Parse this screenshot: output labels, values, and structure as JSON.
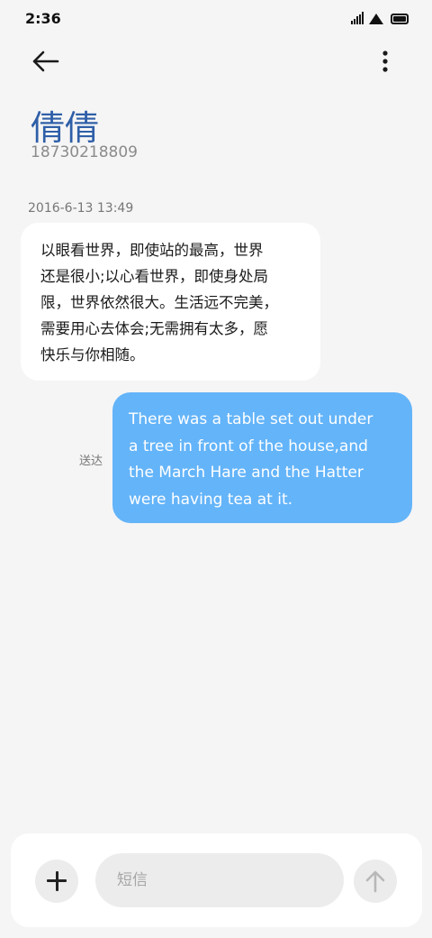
{
  "status_bar": {
    "time": "2:36",
    "icons": [
      "signal-icon",
      "wifi-icon",
      "battery-icon"
    ]
  },
  "toolbar": {
    "back_icon": "arrow-left-icon",
    "more_icon": "more-vertical-icon"
  },
  "contact": {
    "name": "倩倩",
    "number": "18730218809"
  },
  "conversation": {
    "timestamp": "2016-6-13 13:49",
    "incoming": {
      "lines": [
        "以眼看世界，即使站的最高，世界",
        "还是很小;以心看世界，即使身处局",
        "限，世界依然很大。生活远不完美，",
        "需要用心去体会;无需拥有太多，愿",
        "快乐与你相随。"
      ]
    },
    "outgoing": {
      "status": "送达",
      "lines": [
        "There was a table set out under",
        "a tree in front of the house,and",
        "the March Hare and the Hatter",
        "were having tea at it."
      ]
    }
  },
  "composer": {
    "add_icon": "plus-icon",
    "placeholder": "短信",
    "value": "",
    "send_icon": "arrow-up-icon"
  },
  "colors": {
    "accent_name": "#2f5fa8",
    "outgoing_bubble": "#64b4f9",
    "incoming_bubble": "#ffffff",
    "background": "#f5f5f5"
  }
}
